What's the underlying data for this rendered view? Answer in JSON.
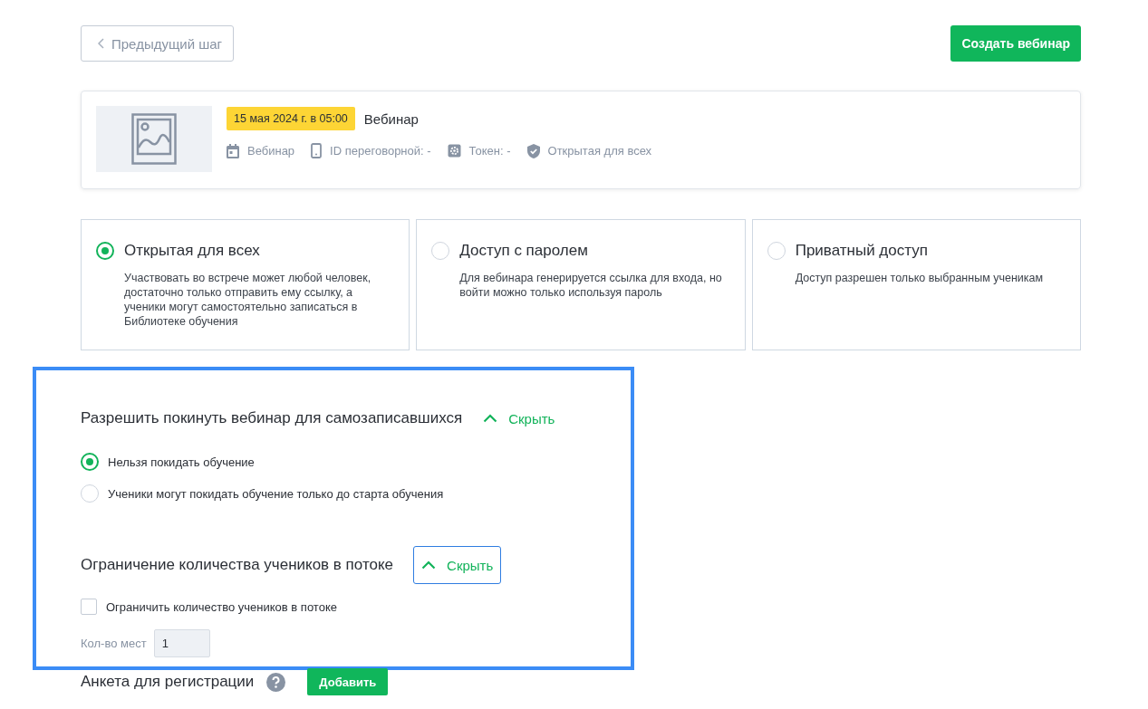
{
  "back_button": {
    "label": "Предыдущий шаг"
  },
  "create_button": {
    "label": "Создать вебинар"
  },
  "webinar_card": {
    "date_badge": "15 мая 2024 г. в 05:00",
    "title": "Вебинар",
    "meta": [
      {
        "kind": "calendar",
        "text": "Вебинар"
      },
      {
        "kind": "phone",
        "text": "ID переговорной: -"
      },
      {
        "kind": "gear",
        "text": "Токен: -"
      },
      {
        "kind": "shield",
        "text": "Открытая для всех"
      }
    ]
  },
  "access_options": [
    {
      "title": "Открытая для всех",
      "description": "Участвовать во встрече может любой человек, достаточно только отправить ему ссылку, а ученики могут самостоятельно записаться в Библиотеке обучения",
      "selected": true
    },
    {
      "title": "Доступ с паролем",
      "description": "Для вебинара генерируется ссылка для входа, но войти можно только используя пароль",
      "selected": false
    },
    {
      "title": "Приватный доступ",
      "description": "Доступ разрешен только выбранным ученикам",
      "selected": false
    }
  ],
  "leave_section": {
    "title": "Разрешить покинуть вебинар для самозаписавшихся",
    "toggle": {
      "label": "Скрыть",
      "focused": false
    },
    "options": [
      {
        "label": "Нельзя покидать обучение",
        "selected": true
      },
      {
        "label": "Ученики могут покидать обучение только до старта обучения",
        "selected": false
      }
    ]
  },
  "limit_section": {
    "title": "Ограничение количества учеников в потоке",
    "toggle": {
      "label": "Скрыть",
      "focused": true
    },
    "checkbox": {
      "label": "Ограничить количество учеников в потоке",
      "checked": false
    },
    "seats": {
      "label": "Кол-во мест",
      "value": "1"
    }
  },
  "registration": {
    "title": "Анкета для регистрации",
    "add_button": "Добавить"
  }
}
